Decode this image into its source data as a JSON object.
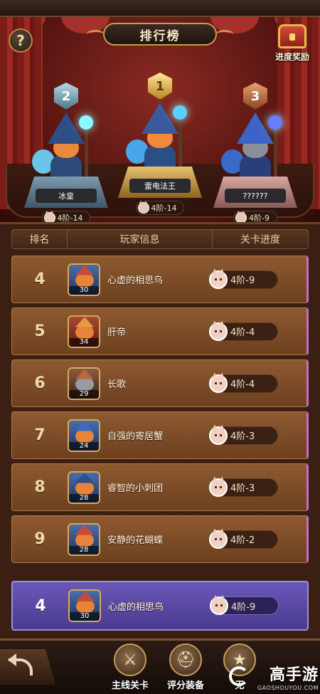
{
  "header": {
    "title": "排行榜",
    "help_symbol": "?",
    "reward_label": "进度奖励"
  },
  "podium": [
    {
      "rank": "2",
      "name": "冰皇",
      "progress": "4阶-14"
    },
    {
      "rank": "1",
      "name": "雷电法王",
      "progress": "4阶-14"
    },
    {
      "rank": "3",
      "name": "??????",
      "progress": "4阶-9"
    }
  ],
  "list": {
    "headers": {
      "rank": "排名",
      "info": "玩家信息",
      "progress": "关卡进度"
    },
    "rows": [
      {
        "rank": "4",
        "level": "30",
        "name": "心虚的相思鸟",
        "progress": "4阶-9"
      },
      {
        "rank": "5",
        "level": "34",
        "name": "肝帝",
        "progress": "4阶-4"
      },
      {
        "rank": "6",
        "level": "29",
        "name": "长歌",
        "progress": "4阶-4"
      },
      {
        "rank": "7",
        "level": "24",
        "name": "自强的寄居蟹",
        "progress": "4阶-3"
      },
      {
        "rank": "8",
        "level": "28",
        "name": "睿智的小刺团",
        "progress": "4阶-3"
      },
      {
        "rank": "9",
        "level": "28",
        "name": "安静的花蝴蝶",
        "progress": "4阶-2"
      }
    ],
    "my_row": {
      "rank": "4",
      "level": "30",
      "name": "心虚的相思鸟",
      "progress": "4阶-9"
    }
  },
  "bottom_nav": {
    "tabs": [
      {
        "label": "主线关卡",
        "icon": "crossed-swords-icon"
      },
      {
        "label": "评分装备",
        "icon": "helmet-icon"
      },
      {
        "label": "无",
        "icon": "star-icon"
      }
    ]
  },
  "watermark": {
    "title": "高手游",
    "url": "GAOSHOUYOU.COM"
  },
  "colors": {
    "curtain": "#8a2a22",
    "row_bg": "#8e5a30",
    "my_row_bg": "#6a58b8",
    "gold": "#c99a4a"
  }
}
